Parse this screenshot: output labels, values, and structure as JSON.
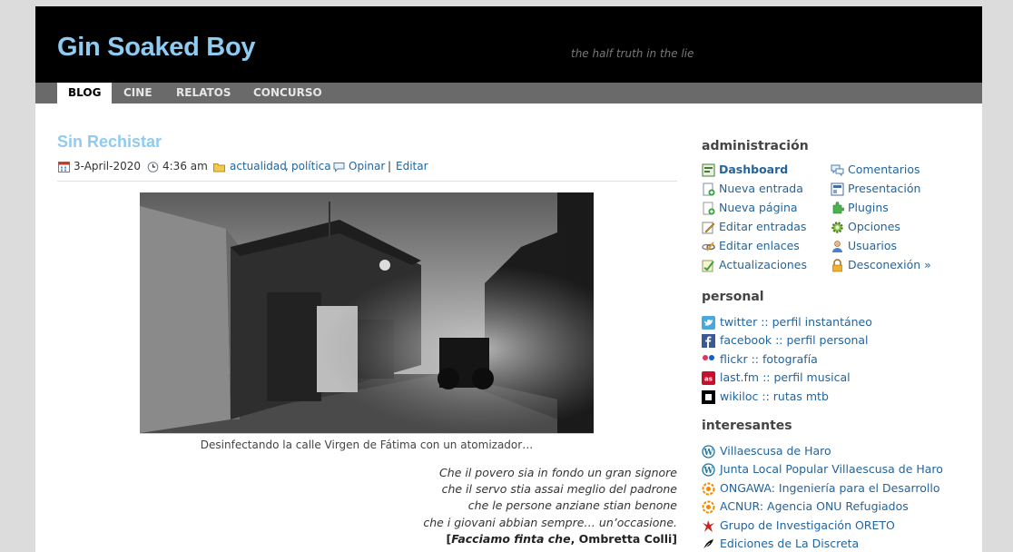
{
  "site": {
    "title": "Gin Soaked Boy",
    "tagline": "the half truth in the lie"
  },
  "nav": {
    "items": [
      "BLOG",
      "CINE",
      "RELATOS",
      "CONCURSO"
    ],
    "active": "BLOG"
  },
  "post": {
    "title": "Sin Rechistar",
    "meta": {
      "date": "3-April-2020",
      "time": "4:36 am",
      "category1": "actualidad",
      "separator": ",",
      "category2": "política",
      "comment_label": "Opinar",
      "pipe": "|",
      "edit_label": "Editar"
    },
    "image_caption": "Desinfectando la calle Virgen de Fátima con un atomizador…",
    "quote_lines": [
      "Che il povero sia in fondo un gran signore",
      "che il servo stia assai meglio del padrone",
      "che le persone anziane stian benone",
      "che i giovani abbian sempre… un’occasione."
    ],
    "quote_attrib_open": "[",
    "quote_attrib_title": "Facciamo finta che",
    "quote_attrib_rest": ", Ombretta Colli]"
  },
  "sidebar": {
    "admin": {
      "heading": "administración",
      "left": [
        "Dashboard",
        "Nueva entrada",
        "Nueva página",
        "Editar entradas",
        "Editar enlaces",
        "Actualizaciones"
      ],
      "right": [
        "Comentarios",
        "Presentación",
        "Plugins",
        "Opciones",
        "Usuarios",
        "Desconexión »"
      ]
    },
    "personal": {
      "heading": "personal",
      "items": [
        {
          "label": "twitter :: perfil instantáneo",
          "icon": "twitter-icon"
        },
        {
          "label": "facebook :: perfil personal",
          "icon": "facebook-icon"
        },
        {
          "label": "flickr :: fotografía",
          "icon": "flickr-icon"
        },
        {
          "label": "last.fm :: perfil musical",
          "icon": "lastfm-icon"
        },
        {
          "label": "wikiloc :: rutas mtb",
          "icon": "wikiloc-icon"
        }
      ]
    },
    "interesantes": {
      "heading": "interesantes",
      "items": [
        {
          "label": "Villaescusa de Haro",
          "icon": "wordpress-icon"
        },
        {
          "label": "Junta Local Popular Villaescusa de Haro",
          "icon": "wordpress-icon"
        },
        {
          "label": "ONGAWA: Ingeniería para el Desarrollo",
          "icon": "ngo-icon"
        },
        {
          "label": "ACNUR: Agencia ONU Refugiados",
          "icon": "ngo-icon"
        },
        {
          "label": "Grupo de Investigación ORETO",
          "icon": "oreto-icon"
        },
        {
          "label": "Ediciones de La Discreta",
          "icon": "feather-icon"
        }
      ]
    }
  },
  "colors": {
    "title_blue": "#8fcbf0",
    "link_blue": "#24649c",
    "header_bg": "#000000",
    "nav_bg": "#6a6a6a"
  }
}
